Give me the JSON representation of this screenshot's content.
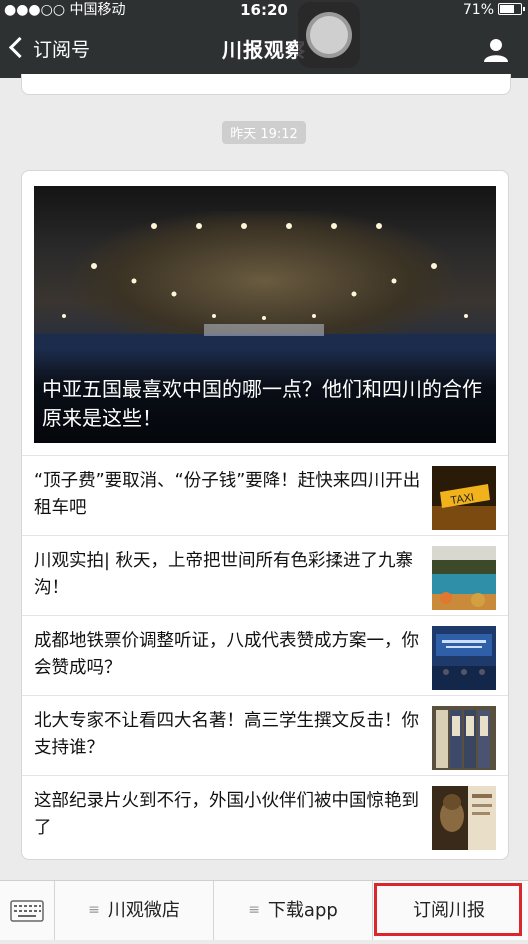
{
  "status_bar": {
    "carrier": "●●●○○ 中国移动",
    "time": "16:20",
    "battery": "71%"
  },
  "nav": {
    "back_label": "订阅号",
    "title": "川报观察",
    "profile_icon": "person-icon"
  },
  "chat": {
    "timestamp": "昨天 19:12",
    "hero_title": "中亚五国最喜欢中国的哪一点？他们和四川的合作原来是这些！",
    "articles": [
      {
        "title": "“顶子费”要取消、“份子钱”要降！赶快来四川开出租车吧",
        "thumb": "taxi-sign"
      },
      {
        "title": "川观实拍| 秋天，上帝把世间所有色彩揉进了九寨沟！",
        "thumb": "jiuzhaigou-lake"
      },
      {
        "title": "成都地铁票价调整听证，八成代表赞成方案一，你会赞成吗？",
        "thumb": "hearing-room"
      },
      {
        "title": "北大专家不让看四大名著！高三学生撰文反击！你支持谁？",
        "thumb": "book-spines"
      },
      {
        "title": "这部纪录片火到不行，外国小伙伴们被中国惊艳到了",
        "thumb": "buddha-statue"
      }
    ]
  },
  "menu": {
    "keyboard_icon": "keyboard-icon",
    "items": [
      "川观微店",
      "下载app",
      "订阅川报"
    ],
    "highlight_color": "#d9272d"
  }
}
